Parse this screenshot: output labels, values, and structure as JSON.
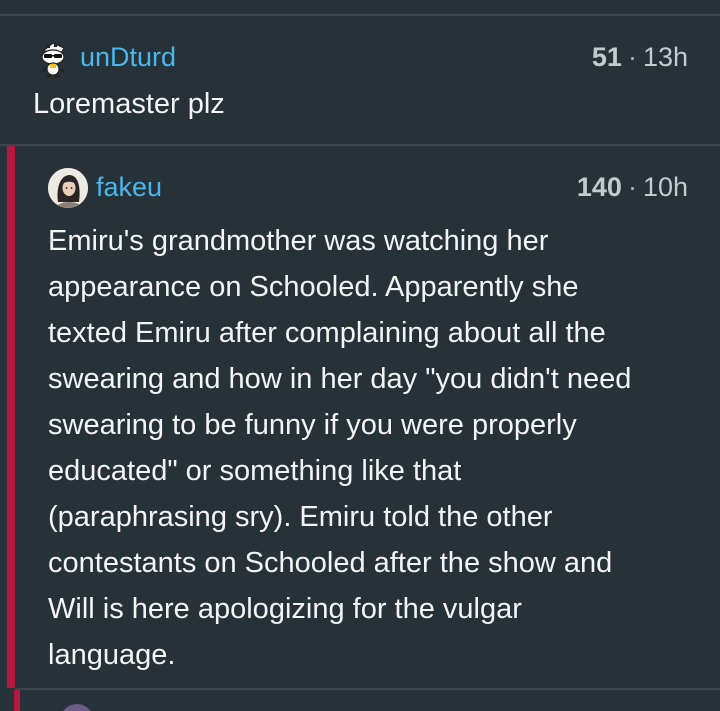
{
  "comments": [
    {
      "username": "unDturd",
      "score": "51",
      "separator": "·",
      "age": "13h",
      "body": "Loremaster plz",
      "avatar_icon": "snoo-avatar-icon"
    },
    {
      "username": "fakeu",
      "score": "140",
      "separator": "·",
      "age": "10h",
      "avatar_icon": "user-avatar-icon",
      "body_lines": [
        "Emiru's grandmother was watching her",
        "appearance on Schooled. Apparently she",
        "texted Emiru after complaining about all the",
        "swearing and how in her day \"you didn't need",
        "swearing to be funny if you were properly",
        "educated\" or something like that",
        "(paraphrasing sry). Emiru told the other",
        "contestants on Schooled after the show and",
        "Will is here apologizing for the vulgar",
        "language."
      ]
    }
  ],
  "colors": {
    "background": "#273238",
    "username": "#4ab6ee",
    "thread_line": "#b5173f",
    "divider": "#3a464d",
    "meta_text": "#c3cbcf",
    "body_text": "#f2f4f5"
  }
}
